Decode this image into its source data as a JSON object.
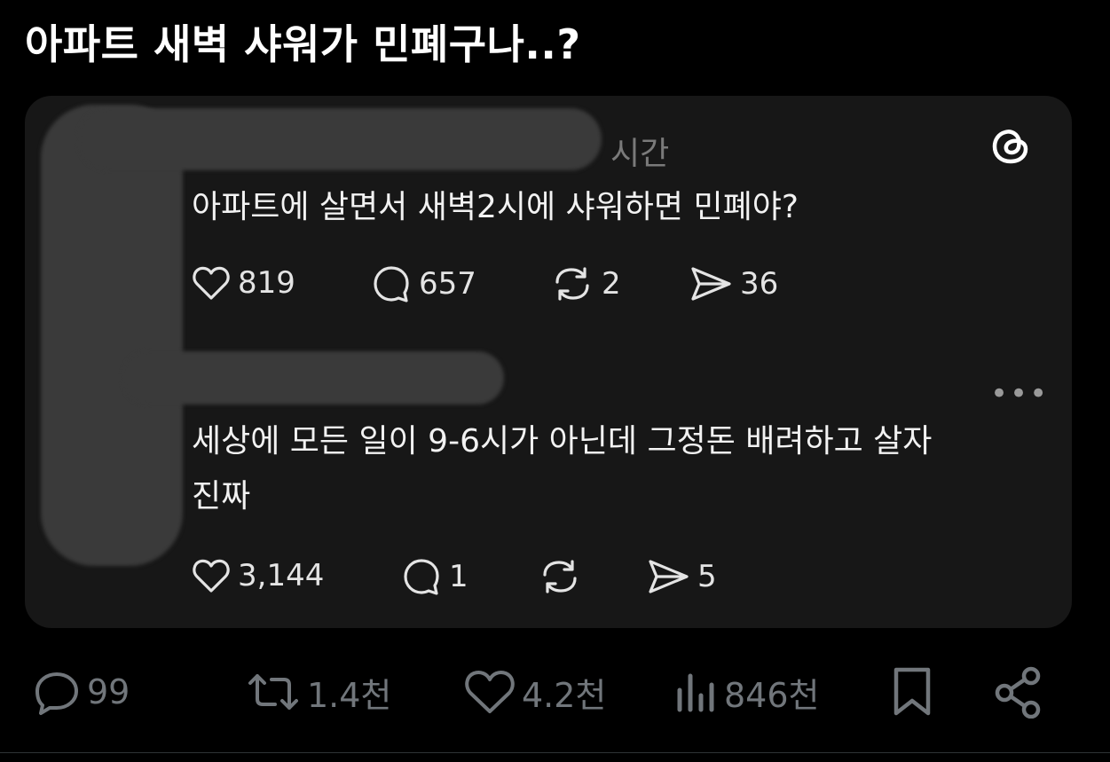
{
  "tweet": {
    "text": "아파트 새벽 샤워가 민폐구나..?"
  },
  "embed": {
    "time_label": "시간",
    "logo_icon": "threads-logo-icon",
    "post1": {
      "text": "아파트에 살면서 새벽2시에 샤워하면 민폐야?",
      "likes": "819",
      "replies": "657",
      "reposts": "2",
      "shares": "36"
    },
    "post2": {
      "text_line1": "세상에 모든 일이 9-6시가 아닌데 그정돈 배려하고 살자",
      "text_line2": "진짜",
      "likes": "3,144",
      "replies": "1",
      "reposts": "",
      "shares": "5"
    },
    "more_label": "•••"
  },
  "actions": {
    "replies": "99",
    "retweets": "1.4천",
    "likes": "4.2천",
    "views": "846천"
  },
  "colors": {
    "background": "#000000",
    "card": "#171717",
    "muted": "#71767b"
  }
}
